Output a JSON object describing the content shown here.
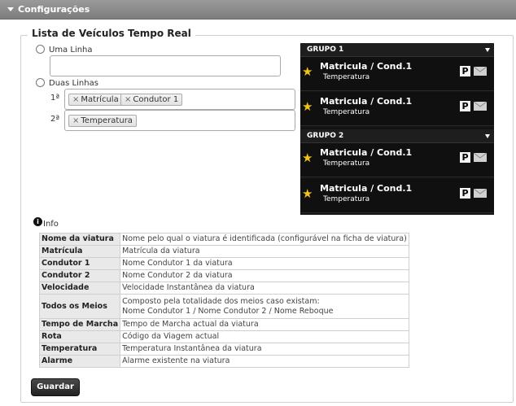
{
  "header": {
    "title": "Configurações"
  },
  "section": {
    "legend": "Lista de Veículos Tempo Real"
  },
  "options": {
    "single_line": {
      "label": "Uma Linha"
    },
    "two_lines": {
      "label": "Duas Linhas"
    },
    "line1_label": "1ª",
    "line2_label": "2ª",
    "line1_tags": [
      "Matrícula",
      "Condutor 1"
    ],
    "line2_tags": [
      "Temperatura"
    ]
  },
  "preview": {
    "groups": [
      {
        "name": "GRUPO 1",
        "rows": [
          {
            "title": "Matricula / Cond.1",
            "subtitle": "Temperatura",
            "badge": "P"
          },
          {
            "title": "Matricula / Cond.1",
            "subtitle": "Temperatura",
            "badge": "P"
          }
        ]
      },
      {
        "name": "GRUPO 2",
        "rows": [
          {
            "title": "Matricula / Cond.1",
            "subtitle": "Temperatura",
            "badge": "P"
          },
          {
            "title": "Matricula / Cond.1",
            "subtitle": "Temperatura",
            "badge": "P"
          }
        ]
      }
    ]
  },
  "info": {
    "label": "Info",
    "rows": [
      {
        "key": "Nome da viatura",
        "value": "Nome pelo qual o viatura é identificada (configurável na ficha de viatura)"
      },
      {
        "key": "Matrícula",
        "value": "Matrícula da viatura"
      },
      {
        "key": "Condutor 1",
        "value": "Nome Condutor 1 da viatura"
      },
      {
        "key": "Condutor 2",
        "value": "Nome Condutor 2 da viatura"
      },
      {
        "key": "Velocidade",
        "value": "Velocidade Instantânea da viatura"
      },
      {
        "key": "Todos os Meios",
        "value": "Composto pela totalidade dos meios caso existam:",
        "value2": "Nome Condutor 1 / Nome Condutor 2 / Nome Reboque"
      },
      {
        "key": "Tempo de Marcha",
        "value": "Tempo de Marcha actual da viatura"
      },
      {
        "key": "Rota",
        "value": "Código da Viagem actual"
      },
      {
        "key": "Temperatura",
        "value": "Temperatura Instantânea da viatura"
      },
      {
        "key": "Alarme",
        "value": "Alarme existente na viatura"
      }
    ]
  },
  "actions": {
    "save_label": "Guardar"
  },
  "colors": {
    "star": "#f0c419",
    "preview_bg": "#141414",
    "header_bg": "#8a8a8a"
  },
  "icons": {
    "star": "star-icon",
    "parking": "parking-icon",
    "mail": "envelope-icon",
    "info": "info-icon",
    "collapse": "chevron-down-icon"
  }
}
